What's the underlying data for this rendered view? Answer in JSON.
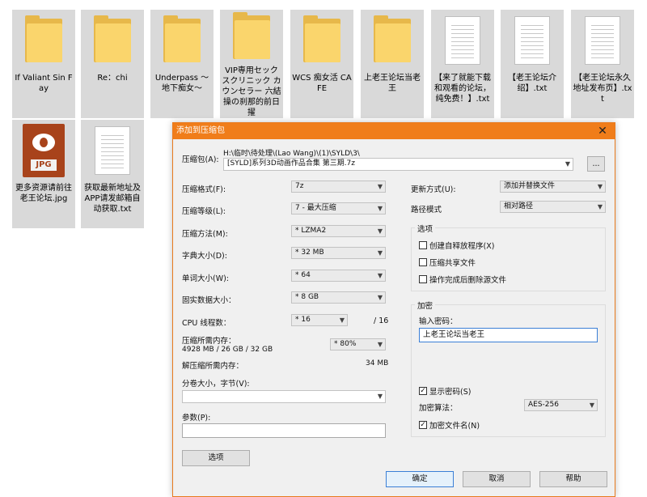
{
  "files_row1": [
    {
      "kind": "folder",
      "name": "If Valiant Sin Fay"
    },
    {
      "kind": "folder",
      "name": "Re：chi"
    },
    {
      "kind": "folder",
      "name": "Underpass ～地下痴女～"
    },
    {
      "kind": "folder",
      "name": "VIP専用セックスクリニック カウンセラー 六結操の刹那的前日擢"
    },
    {
      "kind": "folder",
      "name": "WCS 痴女活 CAFE"
    },
    {
      "kind": "folder",
      "name": "上老王论坛当老王"
    },
    {
      "kind": "txt",
      "name": "【来了就能下载和观看的论坛，纯免费！】.txt"
    },
    {
      "kind": "txt",
      "name": "【老王论坛介绍】.txt"
    },
    {
      "kind": "txt",
      "name": "【老王论坛永久地址发布页】.txt"
    }
  ],
  "files_row2": [
    {
      "kind": "jpg",
      "name": "更多资源请前往老王论坛.jpg",
      "badge": "JPG"
    },
    {
      "kind": "txt",
      "name": "获取最新地址及APP请发邮箱自动获取.txt"
    }
  ],
  "dialog": {
    "title": "添加到压缩包",
    "archive_label": "压缩包(A):",
    "archive_path": "H:\\临时\\待处理\\(Lao Wang)\\(1)\\SYLD\\3\\",
    "archive_name": "[SYLD]系列3D动画作品合集 第三期.7z",
    "browse_label": "...",
    "format_label": "压缩格式(F):",
    "format_value": "7z",
    "level_label": "压缩等级(L):",
    "level_value": "7 - 最大压缩",
    "method_label": "压缩方法(M):",
    "method_value": "* LZMA2",
    "dict_label": "字典大小(D):",
    "dict_value": "* 32 MB",
    "word_label": "单词大小(W):",
    "word_value": "* 64",
    "solid_label": "固实数据大小：",
    "solid_value": "* 8 GB",
    "threads_label": "CPU 线程数：",
    "threads_value": "* 16",
    "threads_total": "/ 16",
    "mem_comp_label": "压缩所需内存：",
    "mem_comp_value": "4928 MB / 26 GB / 32 GB",
    "mem_comp_pct": "* 80%",
    "mem_decomp_label": "解压缩所需内存：",
    "mem_decomp_value": "34 MB",
    "split_label": "分卷大小，字节(V):",
    "split_value": "",
    "params_label": "参数(P):",
    "params_value": "",
    "options_btn": "选项",
    "update_label": "更新方式(U):",
    "update_value": "添加并替换文件",
    "path_label": "路径模式",
    "path_value": "相对路径",
    "options_group": "选项",
    "opt_sfx": "创建自释放程序(X)",
    "opt_shared": "压缩共享文件",
    "opt_delete": "操作完成后删除源文件",
    "enc_group": "加密",
    "password_label": "输入密码：",
    "password_value": "上老王论坛当老王",
    "show_pwd": "显示密码(S)",
    "enc_method_label": "加密算法：",
    "enc_method_value": "AES-256",
    "enc_names": "加密文件名(N)",
    "ok": "确定",
    "cancel": "取消",
    "help": "帮助",
    "close_glyph": "✕",
    "checked_glyph": "✓"
  }
}
